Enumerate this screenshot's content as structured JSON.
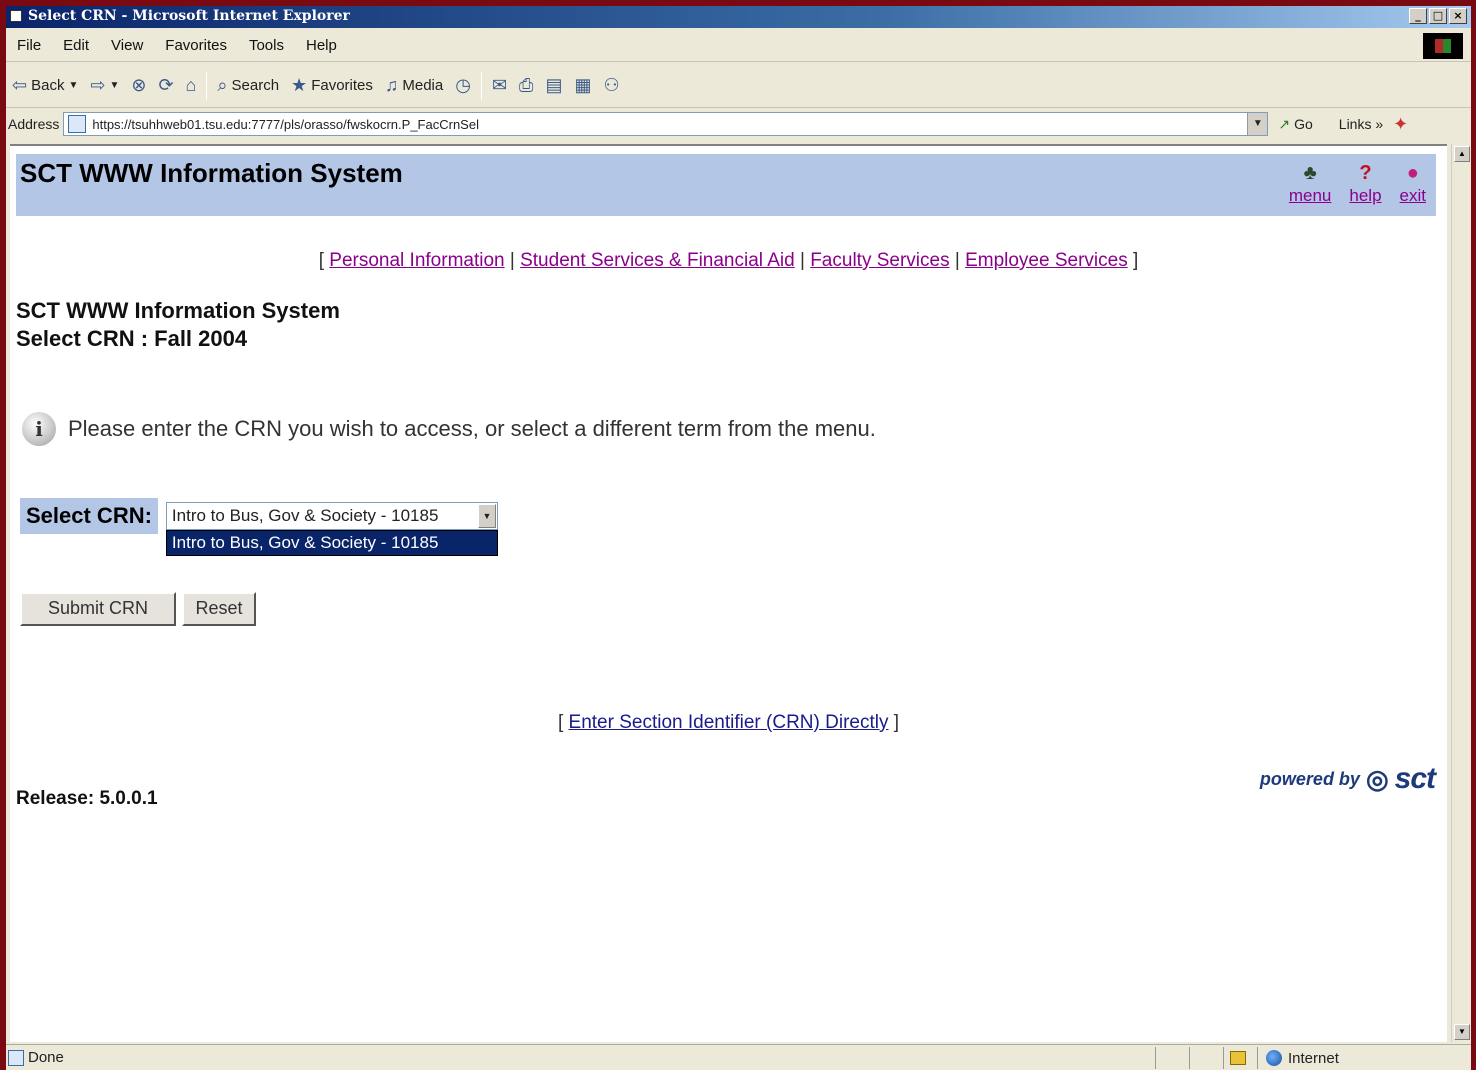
{
  "window": {
    "title": "Select CRN - Microsoft Internet Explorer",
    "controls": [
      "_",
      "□",
      "×"
    ]
  },
  "menu": [
    "File",
    "Edit",
    "View",
    "Favorites",
    "Tools",
    "Help"
  ],
  "toolbar": {
    "back": "Back",
    "search": "Search",
    "favorites": "Favorites",
    "media": "Media"
  },
  "address": {
    "label": "Address",
    "url": "https://tsuhhweb01.tsu.edu:7777/pls/orasso/fwskocrn.P_FacCrnSel",
    "go": "Go",
    "links": "Links"
  },
  "banner": {
    "title": "SCT WWW Information System",
    "menu": "menu",
    "help": "help",
    "exit": "exit"
  },
  "toplinks": {
    "personal": "Personal Information",
    "student": "Student Services & Financial Aid",
    "faculty": "Faculty Services",
    "employee": "Employee Services"
  },
  "heading": {
    "line1": "SCT WWW Information System",
    "line2": "Select CRN : Fall 2004"
  },
  "info": "Please enter the CRN you wish to access, or select a different term from the menu.",
  "form": {
    "label": "Select CRN:",
    "selected": "Intro to Bus, Gov & Society - 10185",
    "option": "Intro to Bus, Gov & Society - 10185",
    "submit": "Submit CRN",
    "reset": "Reset"
  },
  "bottom_link": "Enter Section Identifier (CRN) Directly",
  "release": "Release: 5.0.0.1",
  "powered": {
    "by": "powered by",
    "brand": "sct"
  },
  "status": {
    "text": "Done",
    "zone": "Internet"
  }
}
